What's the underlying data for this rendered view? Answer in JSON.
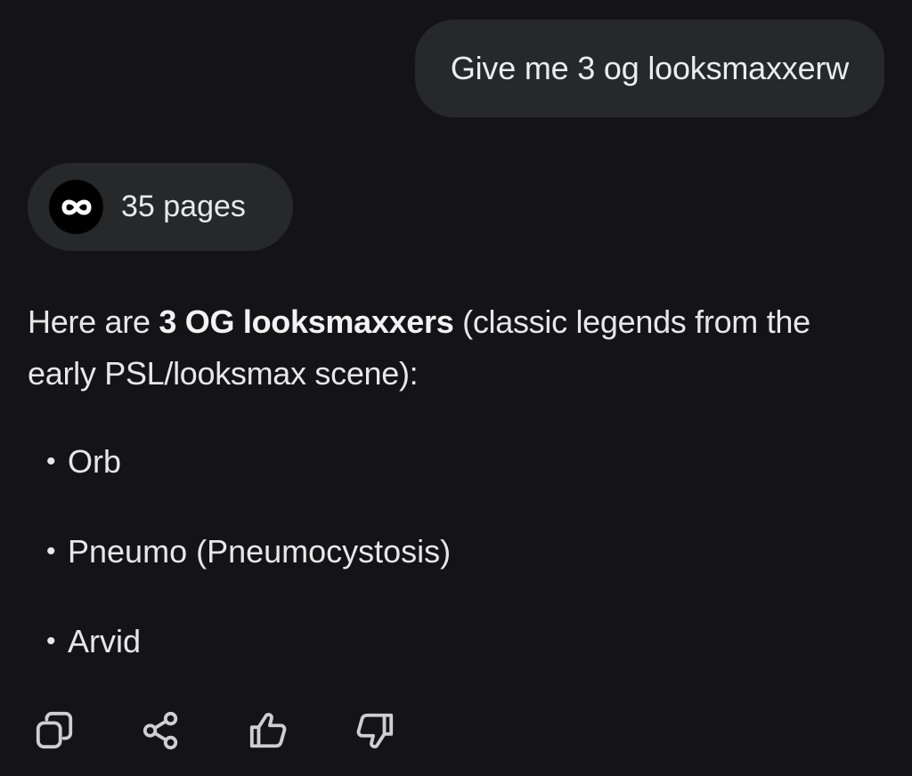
{
  "user_message": {
    "text": "Give me 3 og looksmaxxerw"
  },
  "sources_chip": {
    "label": "35 pages",
    "icon": "infinity-link-icon"
  },
  "answer": {
    "intro_prefix": "Here are ",
    "intro_bold": "3 OG looksmaxxers",
    "intro_suffix": " (classic legends from the early PSL/looksmax scene):",
    "items": [
      {
        "text": "Orb"
      },
      {
        "text": "Pneumo (Pneumocystosis)"
      },
      {
        "text": "Arvid"
      }
    ]
  },
  "actions": [
    {
      "icon": "copy-icon"
    },
    {
      "icon": "share-icon"
    },
    {
      "icon": "thumbs-up-icon"
    },
    {
      "icon": "thumbs-down-icon"
    }
  ],
  "colors": {
    "background": "#141416",
    "bubble": "#27282a",
    "text": "#e7e7e8",
    "icon": "#cfcfd1"
  }
}
